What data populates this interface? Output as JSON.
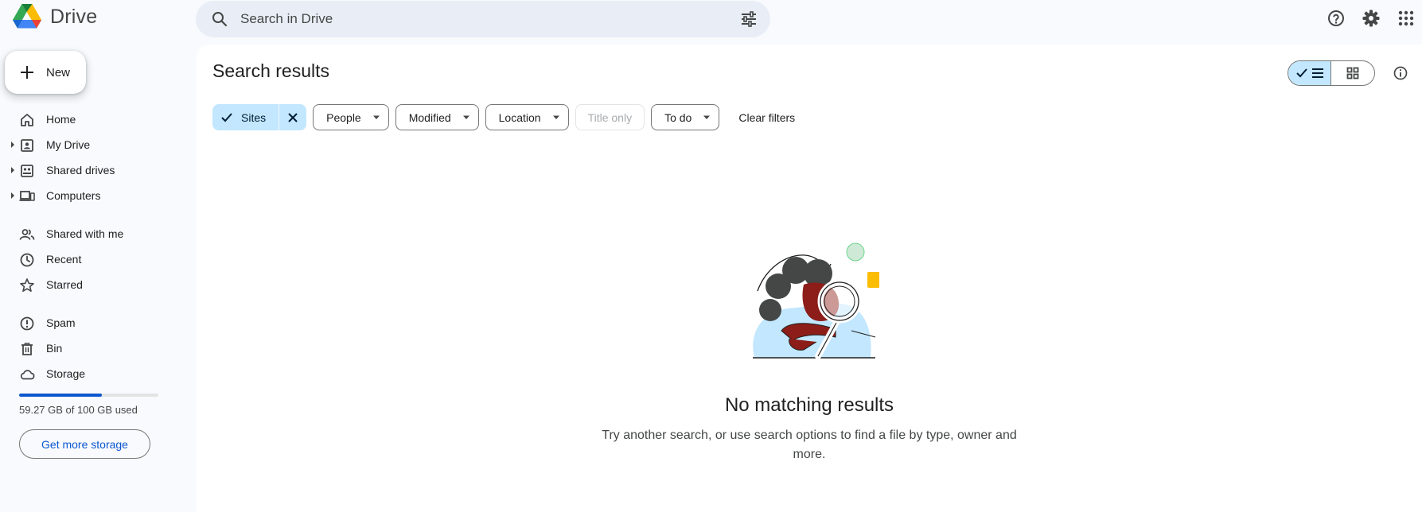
{
  "app": {
    "name": "Drive"
  },
  "search": {
    "placeholder": "Search in Drive"
  },
  "sidebar": {
    "new_label": "New",
    "items": [
      {
        "label": "Home"
      },
      {
        "label": "My Drive"
      },
      {
        "label": "Shared drives"
      },
      {
        "label": "Computers"
      },
      {
        "label": "Shared with me"
      },
      {
        "label": "Recent"
      },
      {
        "label": "Starred"
      },
      {
        "label": "Spam"
      },
      {
        "label": "Bin"
      },
      {
        "label": "Storage"
      }
    ],
    "storage": {
      "used_fraction": 0.5927,
      "used_text": "59.27 GB of 100 GB used",
      "button_label": "Get more storage"
    }
  },
  "main": {
    "title": "Search results",
    "view_mode": "list",
    "filters": {
      "selected_chip": "Sites",
      "dropdowns": [
        {
          "label": "People"
        },
        {
          "label": "Modified"
        },
        {
          "label": "Location"
        }
      ],
      "title_only": "Title only",
      "todo": "To do",
      "clear_label": "Clear filters"
    },
    "empty_state": {
      "title": "No matching results",
      "description": "Try another search, or use search options to find a file by type, owner and more."
    }
  },
  "colors": {
    "accent": "#0b57d0",
    "chip_selected": "#c2e7ff",
    "background": "#f8fafd"
  }
}
